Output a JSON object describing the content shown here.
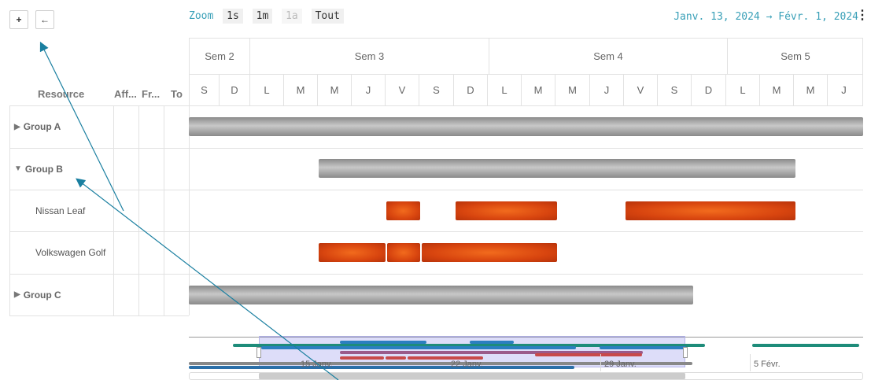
{
  "toolbar": {
    "expand_label": "+",
    "back_label": "←"
  },
  "zoom": {
    "label": "Zoom",
    "options": [
      "1s",
      "1m",
      "1a",
      "Tout"
    ],
    "disabled": "1a"
  },
  "date_range": {
    "start": "Janv. 13, 2024",
    "arrow": "→",
    "end": "Févr. 1, 2024"
  },
  "menu_icon": "⋮",
  "columns": {
    "resource": "Resource",
    "aff": "Aff...",
    "fr": "Fr...",
    "to": "To"
  },
  "weeks": [
    "Sem 2",
    "Sem 3",
    "Sem 4",
    "Sem 5"
  ],
  "days": [
    "S",
    "D",
    "L",
    "M",
    "M",
    "J",
    "V",
    "S",
    "D",
    "L",
    "M",
    "M",
    "J",
    "V",
    "S",
    "D",
    "L",
    "M",
    "M",
    "J"
  ],
  "rows": [
    {
      "label": "Group A",
      "expander": "▶",
      "type": "group"
    },
    {
      "label": "Group B",
      "expander": "▼",
      "type": "group"
    },
    {
      "label": "Nissan Leaf",
      "type": "item"
    },
    {
      "label": "Volkswagen Golf",
      "type": "item"
    },
    {
      "label": "Group C",
      "expander": "▶",
      "type": "group"
    }
  ],
  "navigator": {
    "ticks": [
      "15 Janv.",
      "22 Janv.",
      "29 Janv.",
      "5 Févr."
    ]
  },
  "colors": {
    "accent": "#3aa0b8",
    "bar_gray": "#a0a0a0",
    "bar_red": "#e0500f"
  }
}
